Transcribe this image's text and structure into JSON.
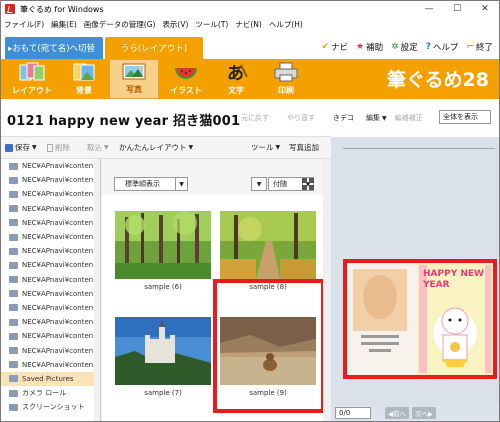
{
  "window": {
    "title": "筆ぐるめ for Windows",
    "minimize": "—",
    "maximize": "☐",
    "close": "✕"
  },
  "menu": [
    "ファイル(F)",
    "編集(E)",
    "画像データの管理(G)",
    "表示(V)",
    "ツール(T)",
    "ナビ(N)",
    "ヘルプ(H)"
  ],
  "mode_tabs": {
    "front": "▸おもて(宛て名)へ切替",
    "back": "うら(レイアウト)"
  },
  "help_links": [
    {
      "icon": "✔",
      "label": "ナビ",
      "color": "#e8a300"
    },
    {
      "icon": "★",
      "label": "補助",
      "color": "#e03a3a"
    },
    {
      "icon": "✲",
      "label": "設定",
      "color": "#3a8a3a"
    },
    {
      "icon": "?",
      "label": "ヘルプ",
      "color": "#2a6fd0"
    },
    {
      "icon": "⌐",
      "label": "終了",
      "color": "#d06a00"
    }
  ],
  "toolbar": {
    "tools": [
      "レイアウト",
      "背景",
      "写真",
      "イラスト",
      "文字",
      "印刷"
    ],
    "active": "写真",
    "brand": "筆ぐるめ28"
  },
  "document": {
    "title": "0121  happy new year  招き猫001",
    "undo": "元に戻す",
    "redo": "やり直す"
  },
  "sub_toolbar": {
    "save": "保存",
    "delete": "削除",
    "import": "取込",
    "easy_layout": "かんたんレイアウト",
    "tools": "ツール",
    "add_photo": "写真追加"
  },
  "tree": {
    "items": [
      "NEC¥APnavi¥conten...",
      "NEC¥APnavi¥conten...",
      "NEC¥APnavi¥conten...",
      "NEC¥APnavi¥conten...",
      "NEC¥APnavi¥conten...",
      "NEC¥APnavi¥conten...",
      "NEC¥APnavi¥conten...",
      "NEC¥APnavi¥conten...",
      "NEC¥APnavi¥conten...",
      "NEC¥APnavi¥conten...",
      "NEC¥APnavi¥conten...",
      "NEC¥APnavi¥conten...",
      "NEC¥APnavi¥conten...",
      "NEC¥APnavi¥conten...",
      "NEC¥APnavi¥conten...",
      "Saved Pictures",
      "カメラ ロール",
      "スクリーンショット"
    ],
    "selected": "Saved Pictures"
  },
  "photos": {
    "sort_label": "標準順表示",
    "date_label": "付随",
    "items": [
      {
        "caption": "sample (6)"
      },
      {
        "caption": "sample (8)"
      },
      {
        "caption": "sample (7)"
      },
      {
        "caption": "sample (9)"
      }
    ],
    "selected": "sample (9)"
  },
  "preview": {
    "deco": "きデコ",
    "edit": "編集",
    "fix": "編補補正",
    "display": "全体を表示",
    "card_text": "HAPPY NEW YEAR",
    "page": "0/0",
    "prev_page": "◀前へ",
    "next_page": "次へ▶"
  },
  "colors": {
    "accent_orange": "#f4a100",
    "tab_blue": "#3e8ed8",
    "highlight_red": "#e81c1c",
    "selected_row": "#fbe3b8"
  }
}
